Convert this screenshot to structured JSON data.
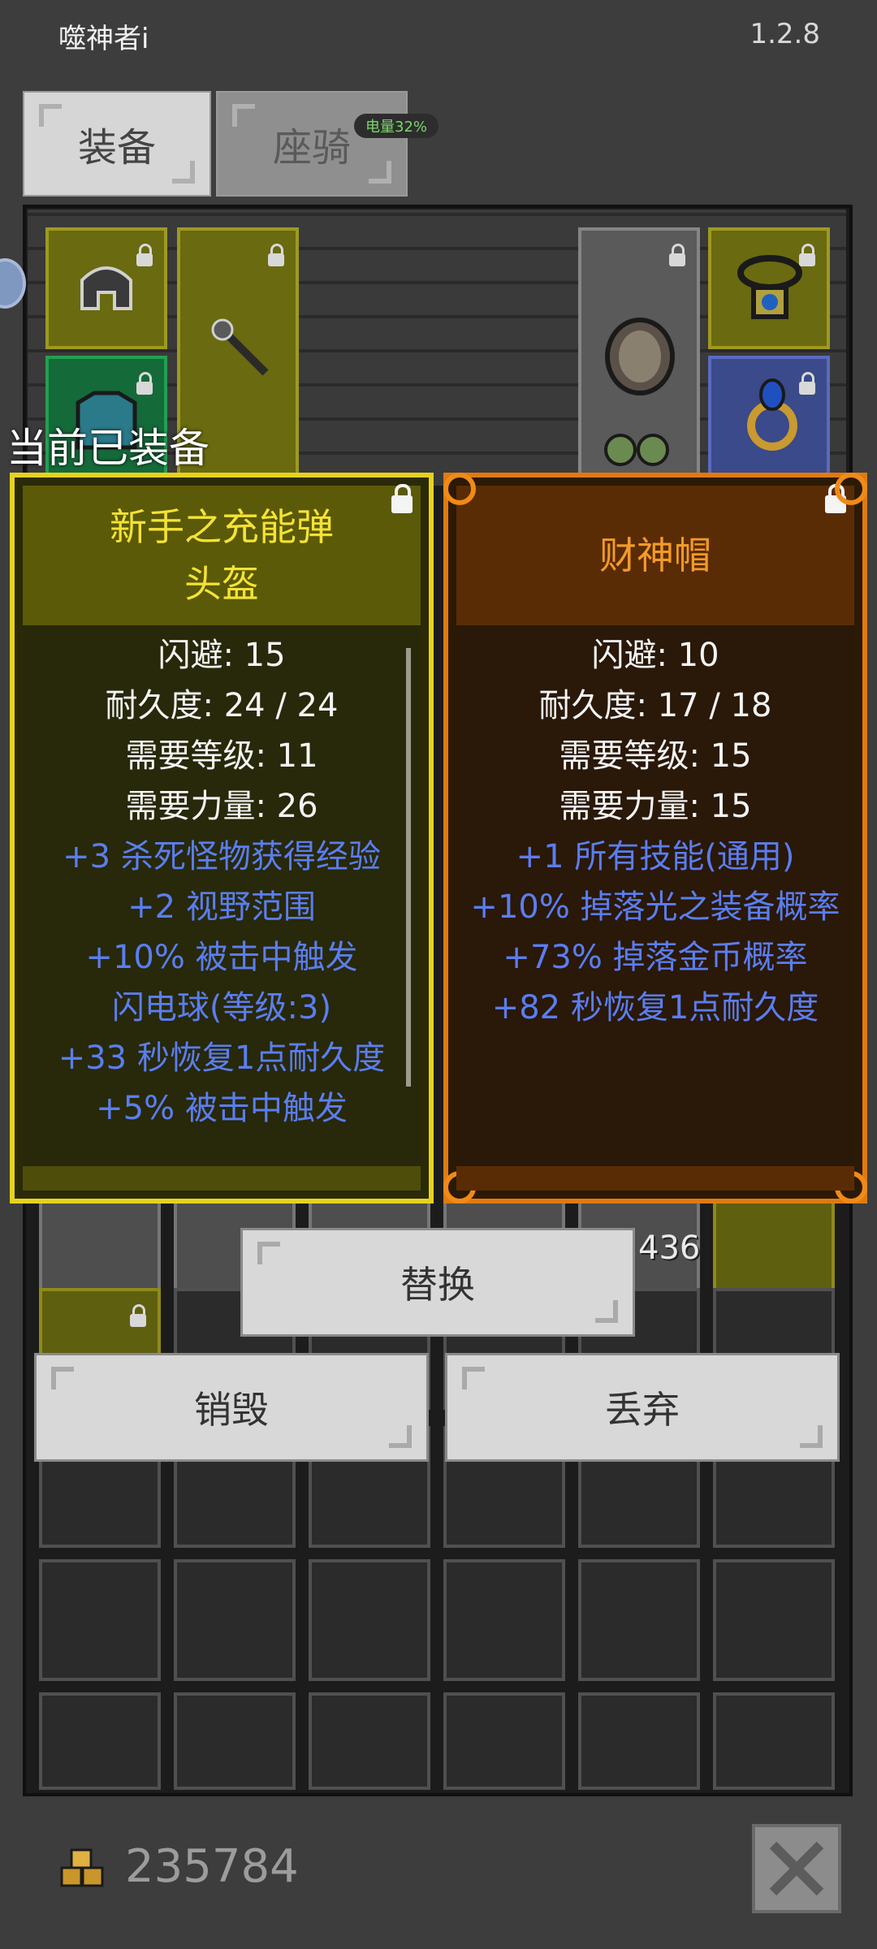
{
  "app": {
    "title": "噬神者i",
    "version": "1.2.8"
  },
  "tabs": [
    {
      "label": "装备",
      "active": true
    },
    {
      "label": "座骑",
      "active": false
    }
  ],
  "battery": "电量32%",
  "equipped_label": "当前已装备",
  "card_left": {
    "name_line1": "新手之充能弹",
    "name_line2": "头盔",
    "stats": [
      "闪避: 15",
      "耐久度: 24 / 24",
      "需要等级: 11",
      "需要力量: 26"
    ],
    "bonuses": [
      "+3 杀死怪物获得经验",
      "+2 视野范围",
      "+10% 被击中触发",
      "闪电球(等级:3)",
      "+33 秒恢复1点耐久度",
      "+5% 被击中触发"
    ]
  },
  "card_right": {
    "name": "财神帽",
    "stats": [
      "闪避: 10",
      "耐久度: 17 / 18",
      "需要等级: 15",
      "需要力量: 15"
    ],
    "bonuses": [
      "+1 所有技能(通用)",
      "+10% 掉落光之装备概率",
      "+73% 掉落金币概率",
      "+82 秒恢复1点耐久度"
    ]
  },
  "buttons": {
    "replace": "替换",
    "destroy": "销毁",
    "discard": "丢弃"
  },
  "inventory": {
    "stack_count": "436"
  },
  "gold": "235784",
  "colors": {
    "legendary_yellow": "#e6d21e",
    "unique_orange": "#e07a10",
    "bonus_blue": "#5a7ef0"
  }
}
